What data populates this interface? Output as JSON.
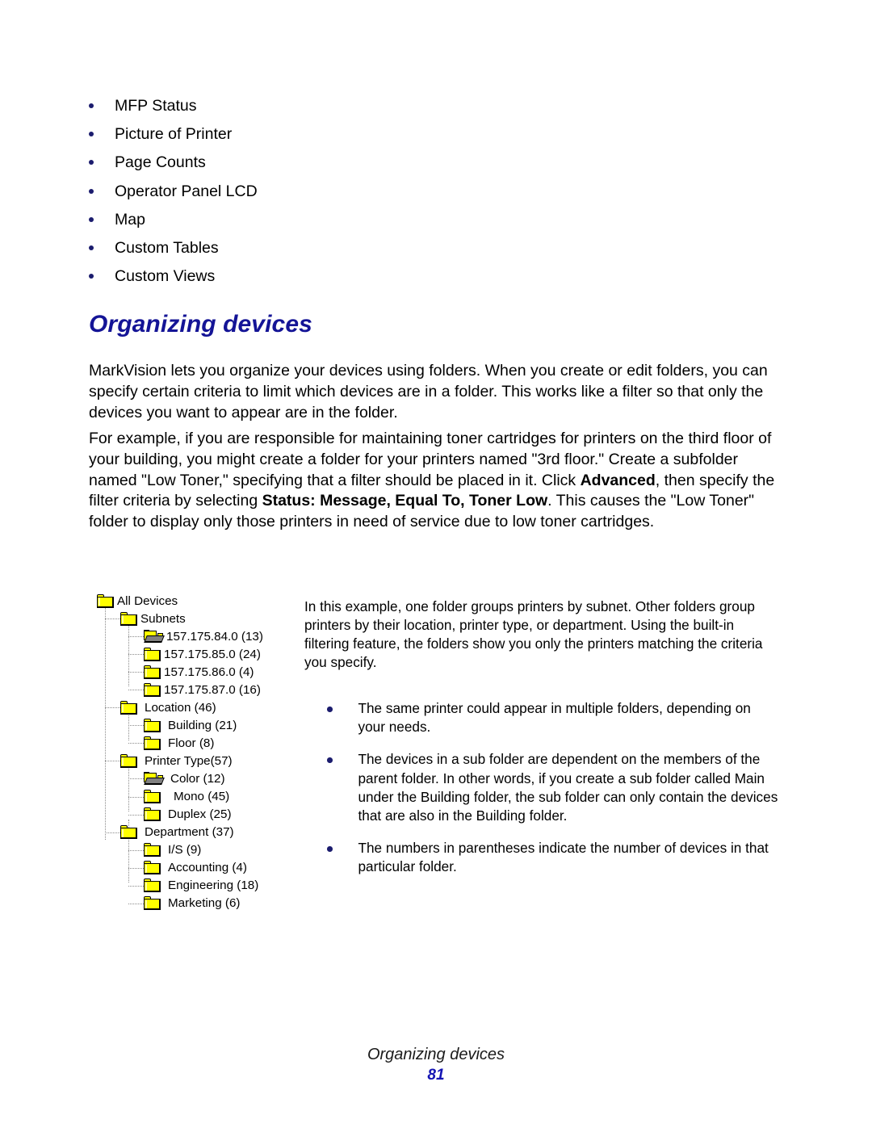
{
  "top_bullets": [
    {
      "label": "MFP Status"
    },
    {
      "label": "Picture of Printer"
    },
    {
      "label": "Page Counts"
    },
    {
      "label": "Operator Panel LCD"
    },
    {
      "label": "Map"
    },
    {
      "label": "Custom Tables"
    },
    {
      "label": "Custom Views"
    }
  ],
  "heading": "Organizing devices",
  "paragraphs": {
    "p1": "MarkVision lets you organize your devices using folders. When you create or edit folders, you can specify certain criteria to limit which devices are in a folder. This works like a filter so that only the devices you want to appear are in the folder.",
    "p2_part1": "For example, if you are responsible for maintaining toner cartridges for printers on the third floor of your building, you might create a folder for your printers named \"3rd floor.\" Create a subfolder named \"Low Toner,\" specifying that a filter should be placed in it. Click ",
    "p2_bold1": "Advanced",
    "p2_part2": ", then specify the filter criteria by selecting ",
    "p2_bold2": "Status: Message, Equal To, Toner Low",
    "p2_part3": ". This causes the \"Low Toner\" folder to display only those printers in need of service due to low toner cartridges."
  },
  "right_column": {
    "intro": "In this example, one folder groups printers by subnet. Other folders group printers by their location, printer type, or department. Using the built-in filtering feature, the folders show you only the printers matching the criteria you specify.",
    "bullets": [
      {
        "label": "The same printer could appear in multiple folders, depending on your needs."
      },
      {
        "label": "The devices in a sub folder are dependent on the members of the parent folder. In other words, if you create a sub folder called Main under the Building folder, the sub folder can only contain the devices that are also in the Building folder."
      },
      {
        "label": "The numbers in parentheses indicate the number of devices in that particular folder."
      }
    ]
  },
  "tree": {
    "nodes": [
      {
        "label": "All Devices",
        "level": 0,
        "icon": "folder-closed-icon"
      },
      {
        "label": "Subnets",
        "level": 1,
        "icon": "folder-closed-icon"
      },
      {
        "label": "157.175.84.0 (13)",
        "level": 2,
        "icon": "folder-open-icon"
      },
      {
        "label": "157.175.85.0 (24)",
        "level": 2,
        "icon": "folder-closed-icon"
      },
      {
        "label": "157.175.86.0 (4)",
        "level": 2,
        "icon": "folder-closed-icon"
      },
      {
        "label": "157.175.87.0 (16)",
        "level": 2,
        "icon": "folder-closed-icon"
      },
      {
        "label": "Location (46)",
        "level": 1,
        "icon": "folder-closed-icon"
      },
      {
        "label": "Building (21)",
        "level": 2,
        "icon": "folder-closed-icon"
      },
      {
        "label": "Floor (8)",
        "level": 2,
        "icon": "folder-closed-icon"
      },
      {
        "label": "Printer Type(57)",
        "level": 1,
        "icon": "folder-closed-icon"
      },
      {
        "label": "Color (12)",
        "level": 2,
        "icon": "folder-open-icon"
      },
      {
        "label": "Mono (45)",
        "level": 2,
        "icon": "folder-closed-icon"
      },
      {
        "label": "Duplex (25)",
        "level": 2,
        "icon": "folder-closed-icon"
      },
      {
        "label": "Department (37)",
        "level": 1,
        "icon": "folder-closed-icon"
      },
      {
        "label": "I/S (9)",
        "level": 2,
        "icon": "folder-closed-icon"
      },
      {
        "label": "Accounting (4)",
        "level": 2,
        "icon": "folder-closed-icon"
      },
      {
        "label": "Engineering (18)",
        "level": 2,
        "icon": "folder-closed-icon"
      },
      {
        "label": "Marketing (6)",
        "level": 2,
        "icon": "folder-closed-icon"
      }
    ]
  },
  "footer": {
    "title": "Organizing devices",
    "page_number": "81"
  },
  "colors": {
    "heading": "#141496",
    "bullet": "#1b1c6e",
    "page_number": "#1414b4",
    "folder_yellow": "#ffff00",
    "folder_open_front": "#808080",
    "tree_line": "#8a8a8a"
  }
}
